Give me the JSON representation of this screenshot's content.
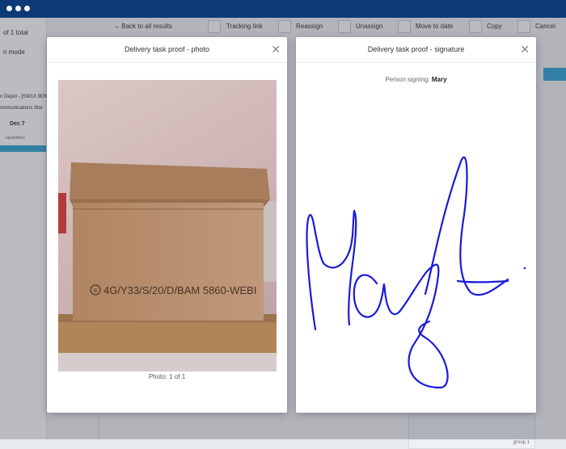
{
  "app": {
    "left_panel": {
      "count_text": "of 1 total",
      "mode_text": "n mode",
      "item_title": "n Depot - [SW1X 9DN]",
      "item_subtitle": "ommunications Stor",
      "date": "Dec 7",
      "tag": "capabilities"
    },
    "toolbar": {
      "back": "Back to all results",
      "tracking": "Tracking link",
      "reassign": "Reassign",
      "unassign": "Unassign",
      "move": "Move to date",
      "copy": "Copy",
      "cancel": "Cancel"
    },
    "bg_card_label": "group 1"
  },
  "photo_modal": {
    "title": "Delivery task proof - photo",
    "caption": "Photo: 1 of 1",
    "box_marking": "4G/Y33/S/20/D/BAM 5860-WEBI"
  },
  "signature_modal": {
    "title": "Delivery task proof - signature",
    "person_label": "Person signing:",
    "person_name": "Mary"
  },
  "colors": {
    "topbar": "#0d3a77",
    "accent": "#38a7d8",
    "signature_ink": "#1a1adb"
  }
}
